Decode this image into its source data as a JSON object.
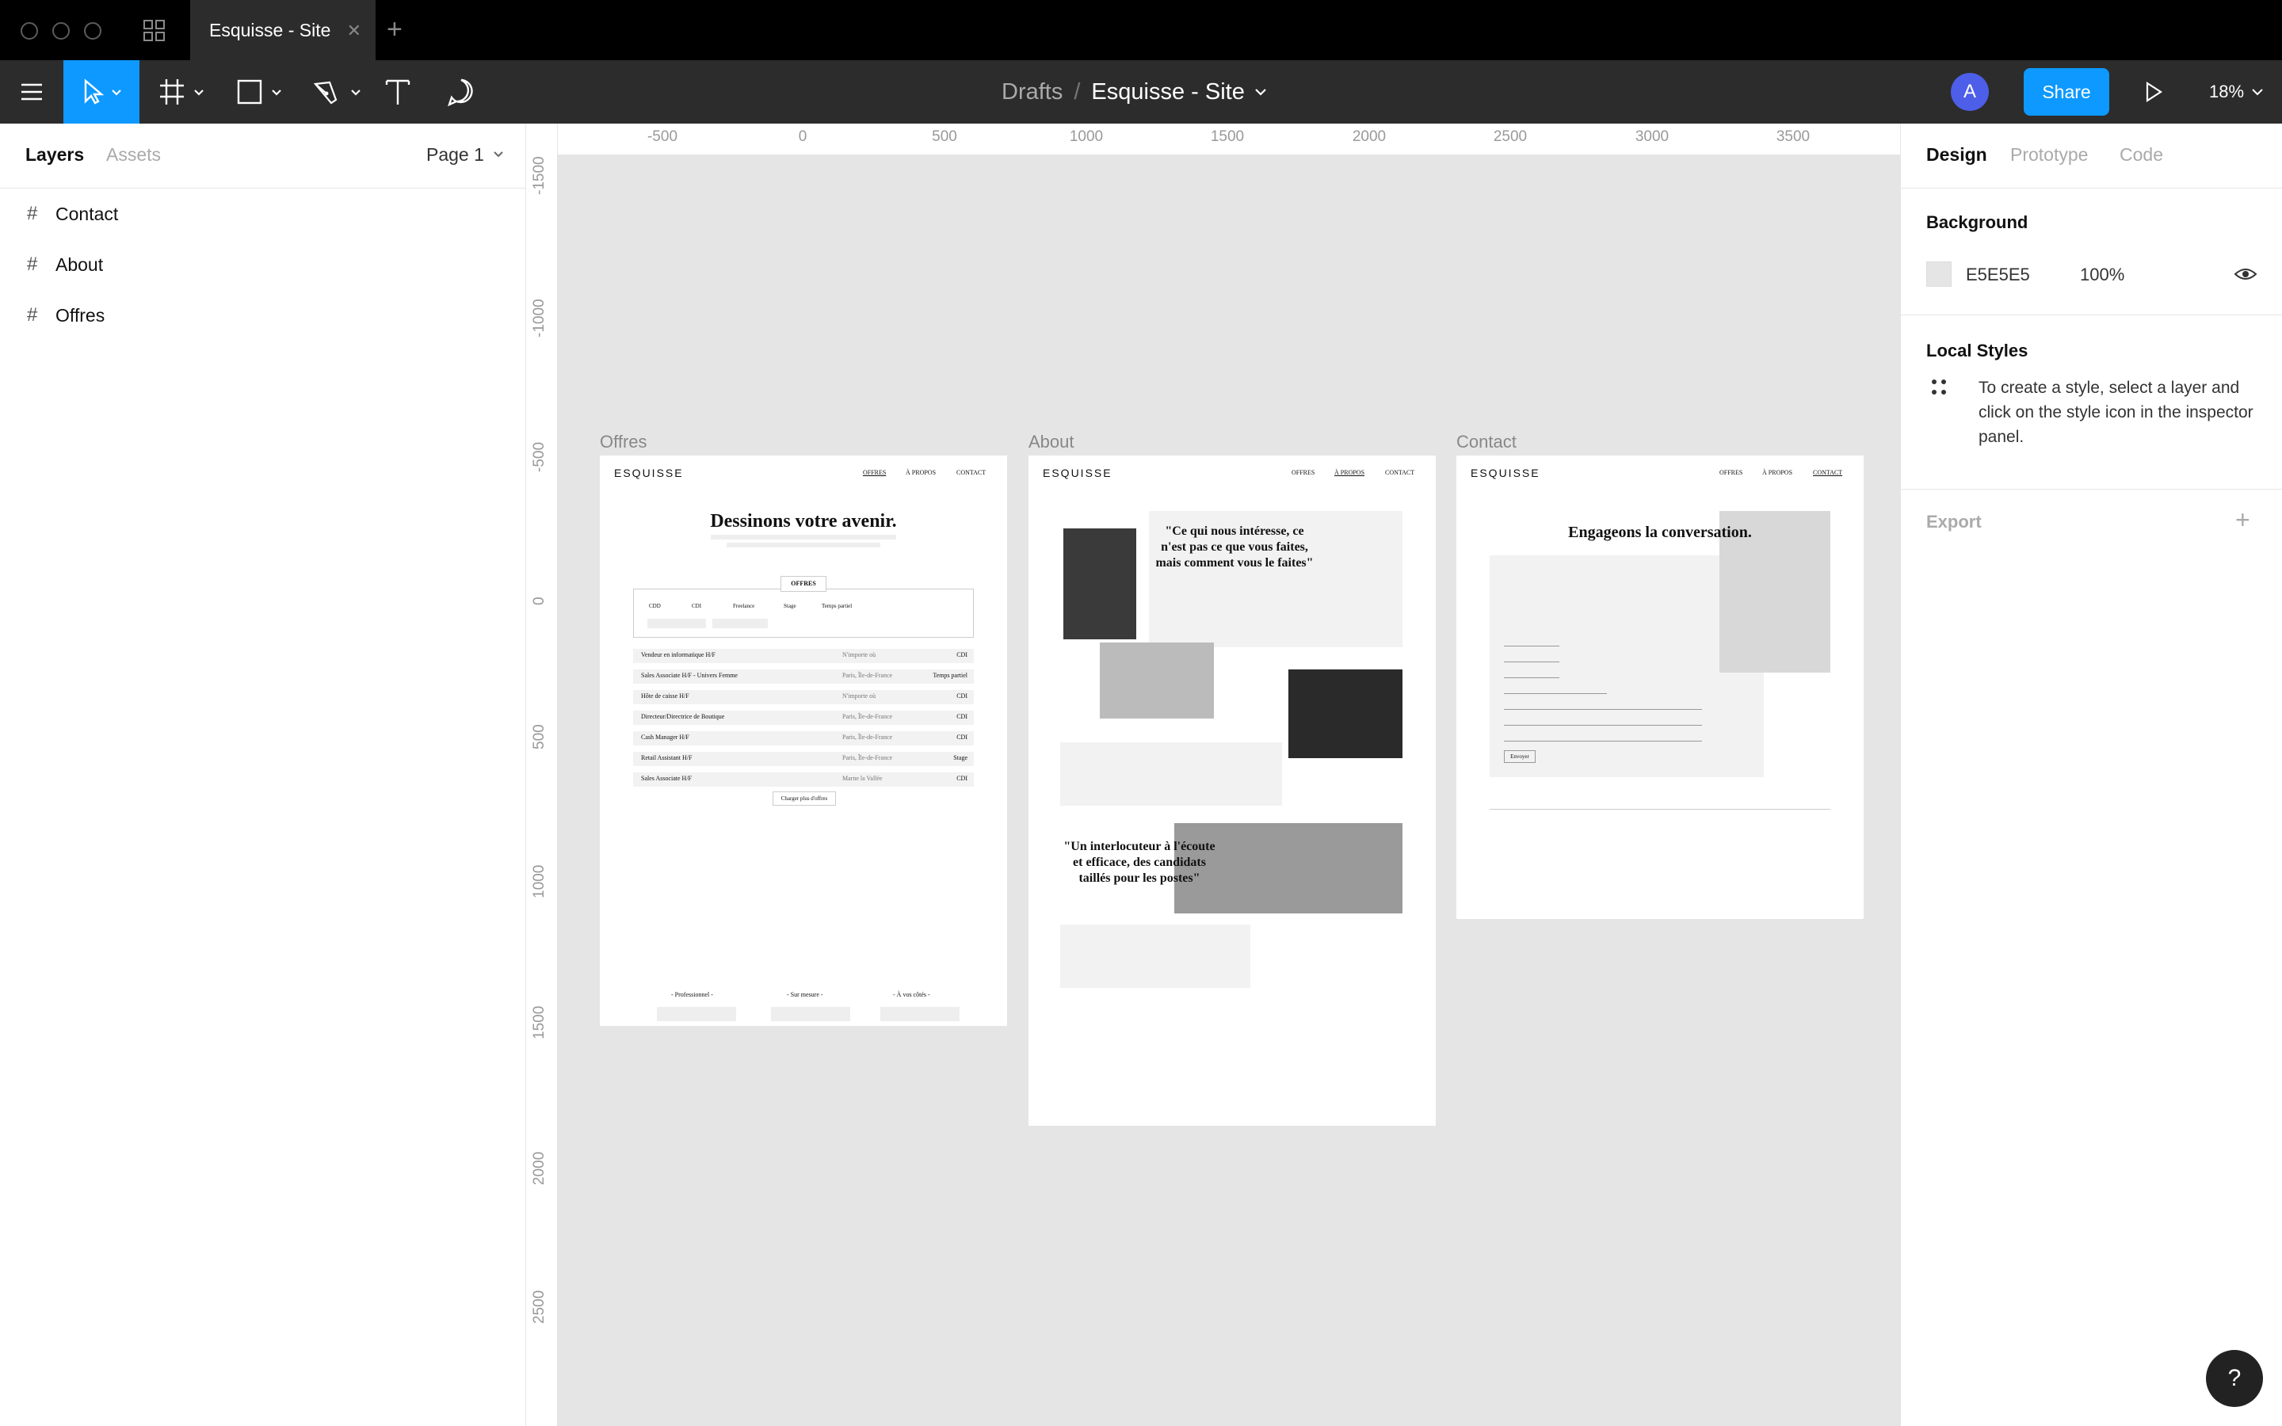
{
  "window": {
    "tab_title": "Esquisse - Site"
  },
  "toolbar": {
    "breadcrumb_parent": "Drafts",
    "separator": "/",
    "file_name": "Esquisse - Site",
    "avatar_initial": "A",
    "share_label": "Share",
    "zoom": "18%"
  },
  "left_panel": {
    "tabs": [
      "Layers",
      "Assets"
    ],
    "page": "Page 1",
    "layers": [
      "Contact",
      "About",
      "Offres"
    ]
  },
  "ruler": {
    "top": [
      "-500",
      "0",
      "500",
      "1000",
      "1500",
      "2000",
      "2500",
      "3000",
      "3500"
    ],
    "left": [
      "-1500",
      "-1000",
      "-500",
      "0",
      "500",
      "1000",
      "1500",
      "2000",
      "2500"
    ]
  },
  "frames": {
    "offres": {
      "label": "Offres",
      "logo": "ESQUISSE",
      "nav": [
        "OFFRES",
        "À PROPOS",
        "CONTACT"
      ],
      "headline": "Dessinons votre avenir.",
      "section": "OFFRES",
      "filters": [
        "CDD",
        "CDI",
        "Freelance",
        "Stage",
        "Temps partiel"
      ],
      "jobs": [
        {
          "title": "Vendeur en informatique H/F",
          "loc": "N'importe où",
          "type": "CDI"
        },
        {
          "title": "Sales Associate H/F - Univers Femme",
          "loc": "Paris, Île-de-France",
          "type": "Temps partiel"
        },
        {
          "title": "Hôte de caisse H/F",
          "loc": "N'importe où",
          "type": "CDI"
        },
        {
          "title": "Directeur/Directrice de Boutique",
          "loc": "Paris, Île-de-France",
          "type": "CDI"
        },
        {
          "title": "Cash Manager H/F",
          "loc": "Paris, Île-de-France",
          "type": "CDI"
        },
        {
          "title": "Retail Assistant H/F",
          "loc": "Paris, Île-de-France",
          "type": "Stage"
        },
        {
          "title": "Sales Associate H/F",
          "loc": "Marne la Vallée",
          "type": "CDI"
        }
      ],
      "more": "Charger plus d'offres",
      "pillars": [
        "- Professionnel -",
        "- Sur mesure -",
        "- À vos côtés -"
      ]
    },
    "about": {
      "label": "About",
      "logo": "ESQUISSE",
      "nav": [
        "OFFRES",
        "À PROPOS",
        "CONTACT"
      ],
      "quote1": "\"Ce qui nous intéresse, ce n'est pas ce que vous faites, mais comment vous le faites\"",
      "quote2": "\"Un interlocuteur à l'écoute et efficace, des candidats taillés pour les postes\""
    },
    "contact": {
      "label": "Contact",
      "logo": "ESQUISSE",
      "nav": [
        "OFFRES",
        "À PROPOS",
        "CONTACT"
      ],
      "headline": "Engageons la conversation.",
      "submit": "Envoyer"
    }
  },
  "right_panel": {
    "tabs": [
      "Design",
      "Prototype",
      "Code"
    ],
    "background_title": "Background",
    "bg_hex": "E5E5E5",
    "bg_opacity": "100%",
    "bg_color": "#e5e5e5",
    "local_styles_title": "Local Styles",
    "local_styles_hint": "To create a style, select a layer and click on the style icon in the inspector panel.",
    "export_title": "Export",
    "export_add": "+"
  },
  "help": "?",
  "colors": {
    "accent": "#0d99ff",
    "selected_tool": "#0d99ff",
    "avatar": "#4d5ee8"
  }
}
